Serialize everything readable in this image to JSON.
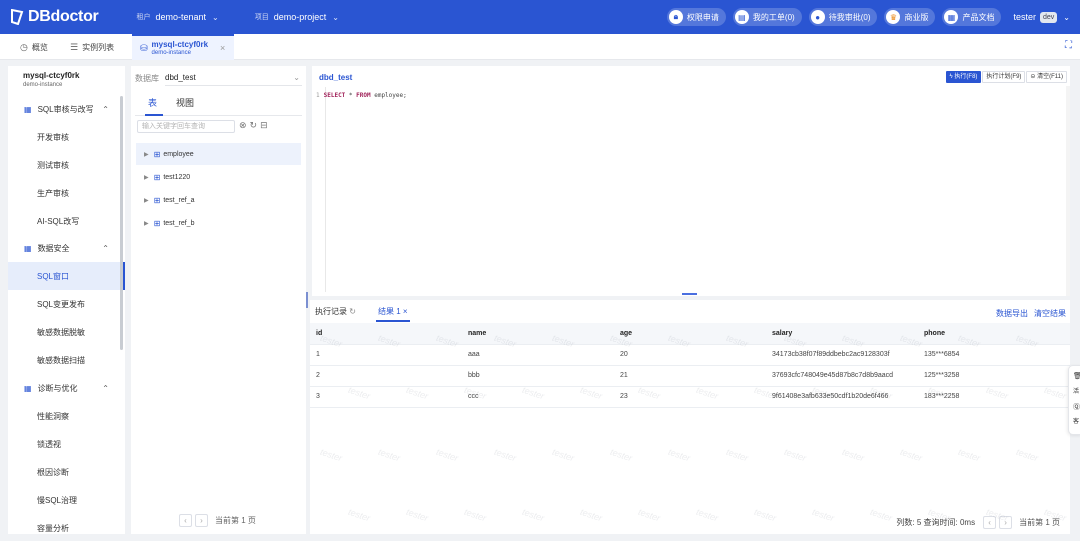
{
  "topbar": {
    "logo_text": "DBdoctor",
    "tenant_label": "租户",
    "tenant_value": "demo-tenant",
    "project_label": "项目",
    "project_value": "demo-project",
    "buttons": [
      {
        "label": "权限申请",
        "icon": "lock-icon"
      },
      {
        "label": "我的工单(0)",
        "icon": "ticket-icon"
      },
      {
        "label": "待我审批(0)",
        "icon": "user-check-icon"
      },
      {
        "label": "商业版",
        "icon": "crown-icon"
      },
      {
        "label": "产品文档",
        "icon": "doc-icon"
      }
    ],
    "user": "tester",
    "env": "dev"
  },
  "tabs": [
    {
      "label": "概览",
      "icon": "dashboard-icon"
    },
    {
      "label": "实例列表",
      "icon": "list-icon"
    },
    {
      "label": "mysql-ctcyf0rk",
      "sub": "demo-instance",
      "icon": "database-icon"
    }
  ],
  "sidebar": {
    "instance_name": "mysql-ctcyf0rk",
    "instance_sub": "demo-instance",
    "sections": [
      {
        "label": "SQL审核与改写",
        "items": [
          "开发审核",
          "测试审核",
          "生产审核",
          "AI-SQL改写"
        ]
      },
      {
        "label": "数据安全",
        "items": [
          "SQL窗口",
          "SQL变更发布",
          "敏感数据脱敏",
          "敏感数据扫描"
        ]
      },
      {
        "label": "诊断与优化",
        "items": [
          "性能洞察",
          "锁透视",
          "根因诊断",
          "慢SQL治理",
          "容量分析"
        ]
      }
    ],
    "active_item": "SQL窗口"
  },
  "objects": {
    "db_label": "数据库",
    "db_value": "dbd_test",
    "tabs": [
      "表",
      "视图"
    ],
    "search_placeholder": "输入关键字回车查询",
    "tables": [
      "employee",
      "test1220",
      "test_ref_a",
      "test_ref_b"
    ],
    "page_text": "当前第 1 页"
  },
  "editor": {
    "title": "dbd_test",
    "buttons": {
      "execute": "执行(F8)",
      "plan": "执行计划(F9)",
      "clear": "清空(F11)"
    },
    "line_no": "1",
    "sql_select": "SELECT",
    "sql_star": " * ",
    "sql_from": "FROM",
    "sql_rest": " employee;"
  },
  "results": {
    "tabs": {
      "history": "执行记录",
      "result": "结果 1"
    },
    "links": {
      "export": "数据导出",
      "clear": "清空结果"
    },
    "columns": [
      "id",
      "name",
      "age",
      "salary",
      "phone"
    ],
    "rows": [
      [
        "1",
        "aaa",
        "20",
        "34173cb38f07f89ddbebc2ac9128303f",
        "135***6854"
      ],
      [
        "2",
        "bbb",
        "21",
        "37693cfc748049e45d87b8c7d8b9aacd",
        "125***3258"
      ],
      [
        "3",
        "ccc",
        "23",
        "9f61408e3afb633e50cdf1b20de6f466",
        "183***2258"
      ]
    ],
    "stats": "列数: 5  查询时间: 0ms",
    "page_text": "当前第 1 页"
  },
  "watermark": "tester",
  "float_tool": {
    "a": "活",
    "b": "客"
  }
}
